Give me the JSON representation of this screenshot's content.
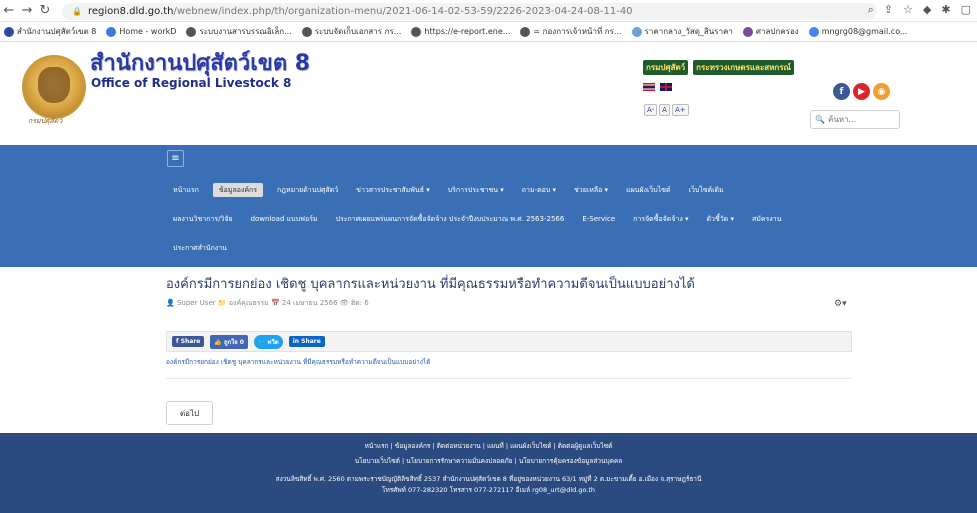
{
  "browser": {
    "url_host": "region8.dld.go.th",
    "url_path": "/webnew/index.php/th/organization-menu/2021-06-14-02-53-59/2226-2023-04-24-08-11-40",
    "bookmarks": [
      {
        "label": "สำนักงานปศุสัตว์เขต 8",
        "color": "#2b4a9e"
      },
      {
        "label": "Home - workD",
        "color": "#3b7be0"
      },
      {
        "label": "ระบบงานสารบรรณอิเล็ก...",
        "color": "#555555"
      },
      {
        "label": "ระบบจัดเก็บเอกสาร กร...",
        "color": "#555555"
      },
      {
        "label": "https://e-report.ene...",
        "color": "#555555"
      },
      {
        "label": "= กองการเจ้าหน้าที่ กร...",
        "color": "#555555"
      },
      {
        "label": "ราคากลาง_วัสดุ_สินราคา",
        "color": "#6aa3d8"
      },
      {
        "label": "ศาลปกครอง",
        "color": "#7a4a9e"
      },
      {
        "label": "mngrg08@gmail.co...",
        "color": "#4285f4"
      }
    ]
  },
  "header": {
    "title_th": "สำนักงานปศุสัตว์เขต 8",
    "title_en": "Office of Regional Livestock 8",
    "logo_caption": "กรมปศุสัตว์",
    "dept_links": [
      "กรมปศุสัตว์",
      "กระทรวงเกษตรและสหกรณ์"
    ],
    "font_sizes": [
      "A-",
      "A",
      "A+"
    ],
    "search_placeholder": "ค้นหา..."
  },
  "nav": {
    "rows": [
      [
        "หน้าแรก",
        "ข้อมูลองค์กร",
        "กฎหมายด้านปศุสัตว์",
        "ข่าวสารประชาสัมพันธ์ ▾",
        "บริการประชาชน ▾",
        "ถาม-ตอบ ▾",
        "ช่วยเหลือ ▾",
        "แผนผังเว็บไซต์",
        "เว็บไซต์เดิม"
      ],
      [
        "ผลงานวิชาการ/วิจัย",
        "download แบบฟอร์ม",
        "ประกาศเผยแพร่แผนการจัดซื้อจัดจ้าง ประจำปีงบประมาณ พ.ศ. 2563-2566",
        "E-Service",
        "การจัดซื้อจัดจ้าง ▾",
        "ตัวชี้วัด ▾",
        "สมัครงาน"
      ],
      [
        "ประกาศสำนักงาน"
      ]
    ],
    "active": "ข้อมูลองค์กร"
  },
  "article": {
    "title": "องค์กรมีการยกย่อง เชิดชู บุคลากรและหน่วยงาน ที่มีคุณธรรมหรือทำความดีจนเป็นแบบอย่างได้",
    "author": "Super User",
    "category": "องค์คุณธรรม",
    "date": "24 เมษายน 2566",
    "hits": "ฮิต: 6",
    "body": "องค์กรมีการยกย่อง เชิดชู บุคลากรและหน่วยงาน ที่มีคุณธรรมหรือทำความดีจนเป็นแบบอย่างได้",
    "next_label": "ต่อไป"
  },
  "share": {
    "facebook": "Share",
    "like": "ถูกใจ 0",
    "twitter": "ทวีต",
    "linkedin": "Share"
  },
  "footer": {
    "line1": "หน้าแรก | ข้อมูลองค์กร | ติดต่อหน่วยงาน | แผนที่ | แผนผังเว็บไซต์ | ติดต่อผู้ดูแลเว็บไซต์",
    "line2": "นโยบายเว็บไซต์ | นโยบายการรักษาความมั่นคงปลอดภัย | นโยบายการคุ้มครองข้อมูลส่วนบุคคล",
    "line3": "สงวนลิขสิทธิ์ พ.ศ. 2560 ตามพระราชบัญญัติลิขสิทธิ์ 2537 สำนักงานปศุสัตว์เขต 8 ที่อยู่ของหน่วยงาน 63/1 หมู่ที่ 2 ต.มะขามเตี้ย อ.เมือง จ.สุราษฎร์ธานี",
    "line4": "โทรศัพท์ 077-282320 โทรสาร 077-272117 อีเมล์ rg08_urt@dld.go.th"
  }
}
